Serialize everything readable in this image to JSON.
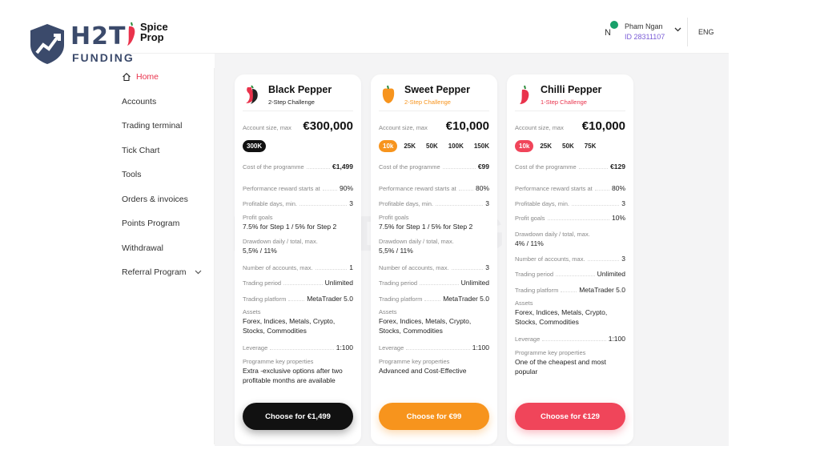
{
  "watermark": {
    "logo_text": "H2T",
    "logo_sub": "FUNDING"
  },
  "brand": {
    "line1": "Spice",
    "line2": "Prop"
  },
  "user": {
    "avatar_initial": "N",
    "name": "Pham Ngan",
    "id": "ID 28311107"
  },
  "language": "ENG",
  "sidebar": {
    "items": [
      {
        "label": "Home",
        "icon": "home-icon",
        "active": true
      },
      {
        "label": "Accounts"
      },
      {
        "label": "Trading terminal"
      },
      {
        "label": "Tick Chart"
      },
      {
        "label": "Tools"
      },
      {
        "label": "Orders & invoices"
      },
      {
        "label": "Points Program"
      },
      {
        "label": "Withdrawal"
      },
      {
        "label": "Referral Program",
        "icon": "chevron-down-icon"
      }
    ]
  },
  "labels": {
    "account_size": "Account size, max",
    "cost": "Cost of the programme",
    "performance": "Performance reward starts at",
    "profitable_days": "Profitable days, min.",
    "profit_goals": "Profit goals",
    "drawdown": "Drawdown daily / total, max.",
    "num_accounts": "Number of accounts, max.",
    "trading_period": "Trading period",
    "trading_platform": "Trading platform",
    "assets": "Assets",
    "leverage": "Leverage",
    "key_props": "Programme key properties"
  },
  "cards": [
    {
      "title": "Black Pepper",
      "subtitle": "2-Step Challenge",
      "subtitle_color": "#222222",
      "icon": "black-pepper-icon",
      "account_size": "€300,000",
      "sizes": [
        "300K"
      ],
      "active_size": "300K",
      "accent": "#111111",
      "cost": "€1,499",
      "performance": "90%",
      "profitable_days": "3",
      "profit_goals": "7.5% for Step 1 / 5% for Step 2",
      "drawdown": "5,5% / 11%",
      "num_accounts": "1",
      "trading_period": "Unlimited",
      "trading_platform": "MetaTrader 5.0",
      "assets": "Forex, Indices, Metals, Crypto, Stocks, Commodities",
      "leverage": "1:100",
      "key_props": "Extra -exclusive options after two profitable months are available",
      "cta": "Choose for €1,499"
    },
    {
      "title": "Sweet Pepper",
      "subtitle": "2-Step Challenge",
      "subtitle_color": "#f7941d",
      "icon": "sweet-pepper-icon",
      "account_size": "€10,000",
      "sizes": [
        "10k",
        "25K",
        "50K",
        "100K",
        "150K"
      ],
      "active_size": "10k",
      "accent": "#f7941d",
      "cost": "€99",
      "performance": "80%",
      "profitable_days": "3",
      "profit_goals": "7.5% for Step 1 / 5% for Step 2",
      "drawdown": "5,5% / 11%",
      "num_accounts": "3",
      "trading_period": "Unlimited",
      "trading_platform": "MetaTrader 5.0",
      "assets": "Forex, Indices, Metals, Crypto, Stocks, Commodities",
      "leverage": "1:100",
      "key_props": "Advanced and Cost-Effective",
      "cta": "Choose for €99"
    },
    {
      "title": "Chilli Pepper",
      "subtitle": "1-Step Challenge",
      "subtitle_color": "#e9334c",
      "icon": "chilli-pepper-icon",
      "account_size": "€10,000",
      "sizes": [
        "10k",
        "25K",
        "50K",
        "75K"
      ],
      "active_size": "10k",
      "accent": "#f0455a",
      "cost": "€129",
      "performance": "80%",
      "profitable_days": "3",
      "profit_goals": "10%",
      "drawdown": "4% / 11%",
      "num_accounts": "3",
      "trading_period": "Unlimited",
      "trading_platform": "MetaTrader 5.0",
      "assets": "Forex, Indices, Metals, Crypto, Stocks, Commodities",
      "leverage": "1:100",
      "key_props": "One of the cheapest and most popular",
      "cta": "Choose for €129"
    }
  ]
}
